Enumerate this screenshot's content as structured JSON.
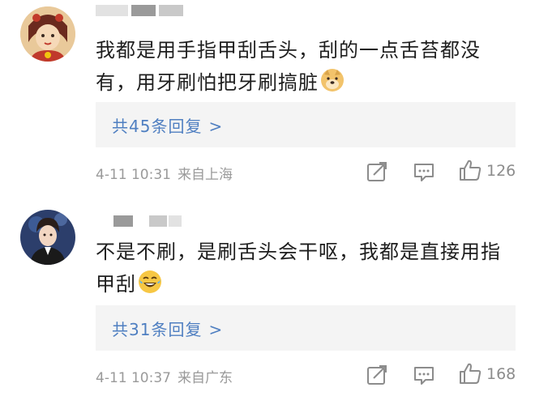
{
  "comments": [
    {
      "avatar_icon": "user-avatar-girl-icon",
      "text": "我都是用手指甲刮舌头，刮的一点舌苔都没有，用牙刷怕把牙刷搞脏",
      "text_line1": "我都是用手指甲刮舌头，刮的一点舌苔都没",
      "text_line2": "有，用牙刷怕把牙刷搞脏",
      "emoji_icon": "doge-emoji-icon",
      "replies_label": "共45条回复",
      "replies_chevron": ">",
      "date": "4-11 10:31",
      "location": "来自上海",
      "likes": "126"
    },
    {
      "avatar_icon": "user-avatar-boy-icon",
      "text": "不是不刷，是刷舌头会干呕，我都是直接用指甲刮",
      "text_line1": "不是不刷，是刷舌头会干呕，我都是直接用指",
      "text_line2": "甲刮",
      "emoji_icon": "laughing-tears-emoji-icon",
      "replies_label": "共31条回复",
      "replies_chevron": ">",
      "date": "4-11 10:37",
      "location": "来自广东",
      "likes": "168"
    }
  ],
  "colors": {
    "link": "#4f7fc1",
    "meta": "#9a9a9a",
    "reply_bg": "#f4f4f4",
    "icon": "#8c8c8c"
  }
}
